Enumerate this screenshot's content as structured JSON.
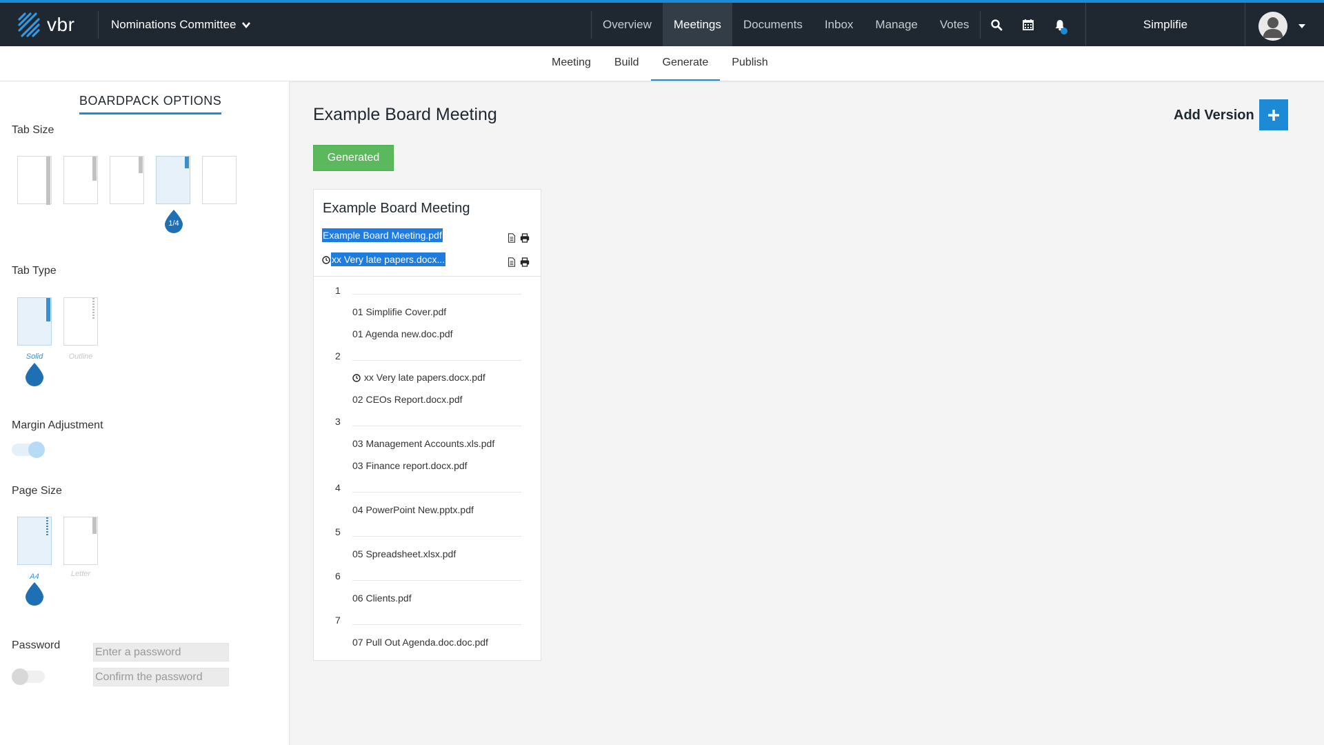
{
  "app": {
    "logo_text": "vbr",
    "committee": "Nominations Committee"
  },
  "nav": {
    "items": [
      "Overview",
      "Meetings",
      "Documents",
      "Inbox",
      "Manage",
      "Votes"
    ],
    "active": "Meetings",
    "icons": [
      "search-icon",
      "calendar-icon",
      "bell-icon"
    ],
    "user": "Simplifie"
  },
  "subnav": {
    "items": [
      "Meeting",
      "Build",
      "Generate",
      "Publish"
    ],
    "active": "Generate"
  },
  "options": {
    "title": "BOARDPACK OPTIONS",
    "tab_size": {
      "label": "Tab Size",
      "selected_label": "1/4"
    },
    "tab_type": {
      "label": "Tab Type",
      "choices": [
        "Solid",
        "Outline"
      ],
      "selected": "Solid"
    },
    "margin": {
      "label": "Margin Adjustment",
      "enabled": true
    },
    "page_size": {
      "label": "Page Size",
      "choices": [
        "A4",
        "Letter"
      ],
      "selected": "A4"
    },
    "password": {
      "label": "Password",
      "enabled": false,
      "placeholder": "Enter a password",
      "confirm_placeholder": "Confirm the password"
    }
  },
  "meeting": {
    "title": "Example Board Meeting",
    "add_version": "Add Version",
    "status": "Generated",
    "card": {
      "title": "Example Board Meeting",
      "files": [
        "Example Board Meeting.pdf",
        "xx Very late papers.docx..."
      ],
      "sections": [
        {
          "num": "1",
          "docs": [
            "01 Simplifie Cover.pdf",
            "01 Agenda new.doc.pdf"
          ]
        },
        {
          "num": "2",
          "docs": [
            "xx Very late papers.docx.pdf",
            "02 CEOs Report.docx.pdf"
          ]
        },
        {
          "num": "3",
          "docs": [
            "03 Management Accounts.xls.pdf",
            "03 Finance report.docx.pdf"
          ]
        },
        {
          "num": "4",
          "docs": [
            "04 PowerPoint New.pptx.pdf"
          ]
        },
        {
          "num": "5",
          "docs": [
            "05 Spreadsheet.xlsx.pdf"
          ]
        },
        {
          "num": "6",
          "docs": [
            "06 Clients.pdf"
          ]
        },
        {
          "num": "7",
          "docs": [
            "07 Pull Out Agenda.doc.doc.pdf"
          ]
        }
      ]
    }
  },
  "colors": {
    "accent": "#1d8ad6",
    "nav_bg": "#1f2730",
    "success": "#5cb85c",
    "highlight": "#1e7be0"
  }
}
